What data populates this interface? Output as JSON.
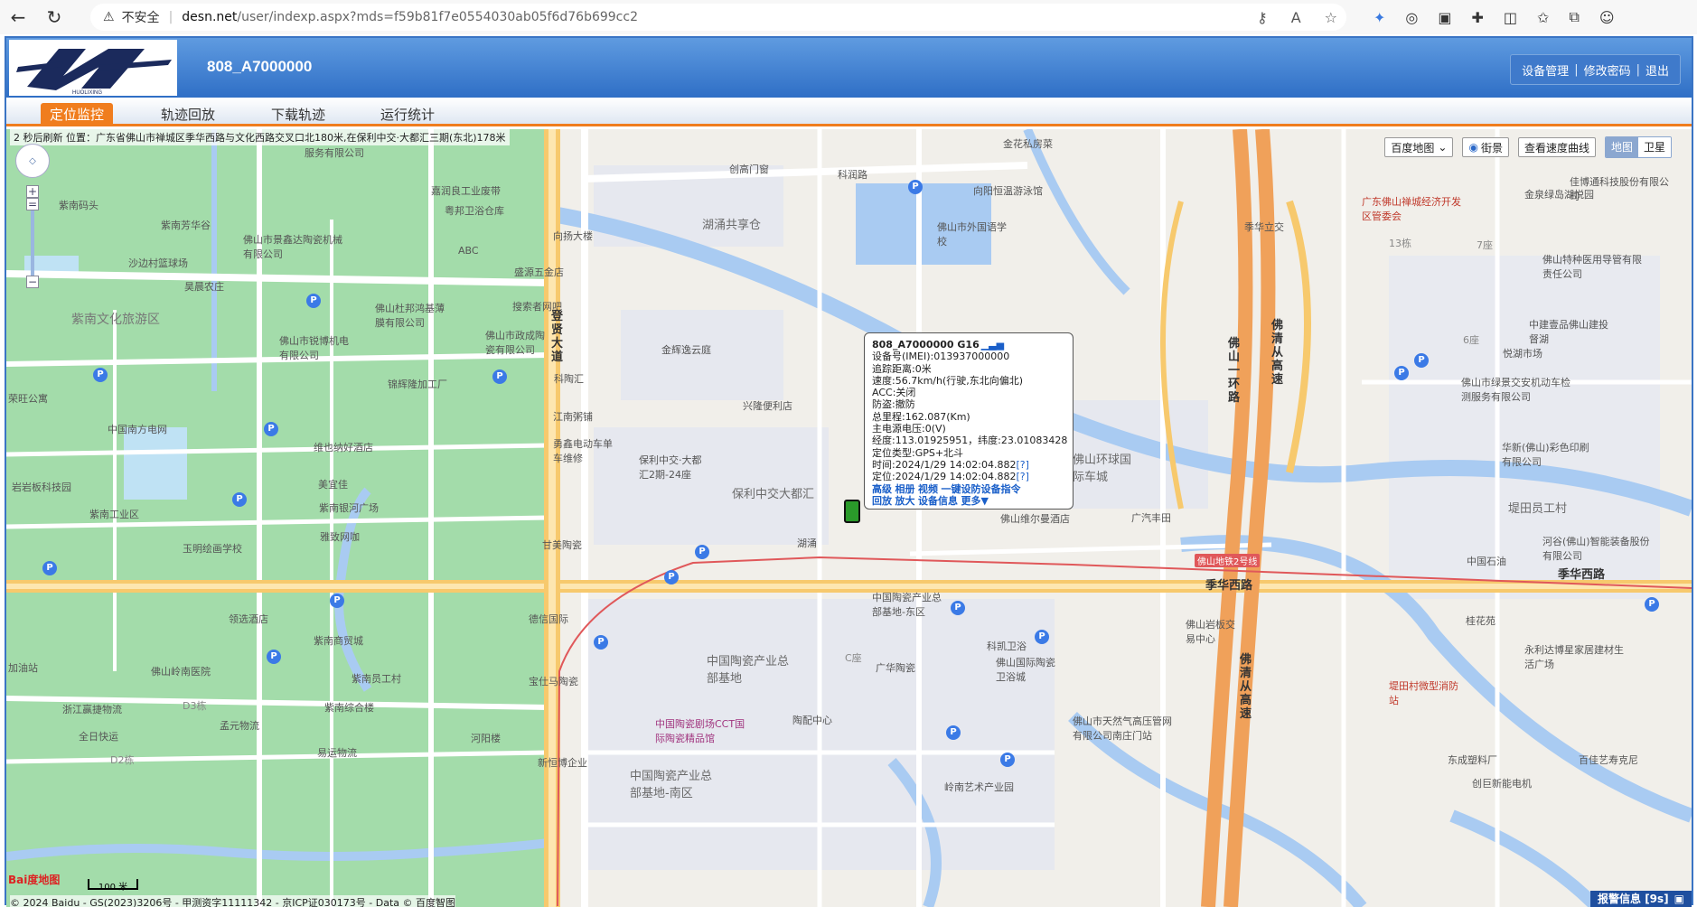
{
  "browser": {
    "insecure_label": "不安全",
    "url_host": "desn.net",
    "url_path": "/user/indexp.aspx?mds=f59b81f7e0554030ab05f6d76b699cc2"
  },
  "header": {
    "logo_text": "HUOLIXING",
    "device_title": "808_A7000000",
    "links": [
      "设备管理",
      "修改密码",
      "退出"
    ]
  },
  "tabs": [
    {
      "label": "定位监控",
      "active": true
    },
    {
      "label": "轨迹回放",
      "active": false
    },
    {
      "label": "下载轨迹",
      "active": false
    },
    {
      "label": "运行统计",
      "active": false
    }
  ],
  "map": {
    "status_line": "2 秒后刷新   位置：广东省佛山市禅城区季华西路与文化西路交叉口北180米,在保利中交·大都汇三期(东北)178米",
    "controls": {
      "map_select": "百度地图",
      "street_view": "街景",
      "speed_curve": "查看速度曲线",
      "type_map": "地图",
      "type_satellite": "卫星"
    },
    "labels": {
      "huyong_gongxiang": "湖涌共享仓",
      "kerun_road": "科润路",
      "chuangmen": "创高门窗",
      "jinfang": "金花私房菜",
      "xiangyang": "向阳恒温游泳馆",
      "foreign_school": "佛山市外国语学校",
      "jiruiliang": "嘉润良工业废带",
      "yuebang": "粤邦卫浴仓库",
      "xiangyang_building": "向扬大楼",
      "abc": "ABC",
      "shengyuan": "盛源五金店",
      "sousuo": "搜索者网吧",
      "jingxin_jinhe": "金辉逸云庭",
      "kefurun": "科陶汇",
      "xinglong": "兴隆便利店",
      "jiangnan": "江南粥铺",
      "yongxin": "勇鑫电动车单车维修",
      "baoli_24": "保利中交·大都汇2期-24座",
      "baoli_dadu": "保利中交大都汇",
      "huyong": "湖涌",
      "dengxian_road": "登贤大道",
      "foshan_ring": "佛山一环路",
      "foqing_highway": "佛清从高速",
      "jihua_west": "季华西路",
      "jihua_li": "季华立交",
      "jihua_west_right": "季华西路",
      "foshan_ring_auto": "佛山环球国际车城",
      "guangqi_fengtian": "广汽丰田",
      "foshan_weierman": "佛山维尔曼酒店",
      "metro_line2": "佛山地铁2号线",
      "ceramics_east": "中国陶瓷产业总部基地-东区",
      "ceramics_hq": "中国陶瓷产业总部基地",
      "ceramics_theatre": "中国陶瓷剧场CCT国际陶瓷精品馆",
      "ceramics_south": "中国陶瓷产业总部基地-南区",
      "taopei": "陶配中心",
      "kekai": "科凯卫浴",
      "foshan_intl_ceramic": "佛山国际陶瓷卫浴城",
      "guanghua": "广华陶瓷",
      "tianran_gas": "佛山市天然气高压管网有限公司南庄门站",
      "lingnan_art": "岭南艺术产业园",
      "xinhengbo": "新恒博企业",
      "baozhi": "宝仕马陶瓷",
      "deli_intl": "德信国际",
      "ganmei": "甘美陶瓷",
      "jingxin_ceramic": "佛山市景鑫达陶瓷机械有限公司",
      "dujuanhong": "佛山杜邦鸿基薄膜有限公司",
      "ruibo": "佛山市锐博机电有限公司",
      "zhengcheng": "佛山市政成陶瓷有限公司",
      "jinpeng": "锦辉隆加工厂",
      "zhongguo_nanfang": "中国南方电网",
      "weiyena": "维也纳好酒店",
      "meiyijia": "美宜佳",
      "ziwu_ruixin": "紫南银河广场",
      "yaxuan_wangka": "雅致网咖",
      "yuming_school": "玉明绘画学校",
      "ziwu_industrial": "紫南工业区",
      "yanyanban": "岩岩板科技园",
      "ziwu_culture": "紫南文化旅游区",
      "shagong_basketball": "沙边村篮球场",
      "ximeizhuang": "昊晨农庄",
      "ziwu_fangyuan": "紫南芳华谷",
      "ziwu_matou": "紫南码头",
      "shabian_park": "荣旺公寓",
      "fuwu_co": "服务有限公司",
      "lingnan_hospital": "佛山岭南医院",
      "zhejiang_logistics": "浙江赢捷物流",
      "quanri_kuaiyun": "全日快运",
      "mengyuan_logistics": "孟元物流",
      "ziwu_zonghe": "紫南综合楼",
      "yida_logistics": "易运物流",
      "hepan_building": "河阳楼",
      "ziwu_yuangong": "紫南员工村",
      "ziwu_shangmao": "紫南商贸城",
      "lingxian_hotel": "领选酒店",
      "jiayou": "加油站",
      "industrial_zone_dev": "广东佛山禅城经济开发区管委会",
      "jinquan_logistics": "金泉绿岛湖悦园",
      "foshan_tejuan": "佛山特种医用导管有限责任公司",
      "zhongjian": "中建壹品佛山建投督湖",
      "yueyang_market": "悦湖市场",
      "lvyou_jiao": "佛山市绿景交安机动车检测服务有限公司",
      "huaxin_color": "华新(佛山)彩色印刷有限公司",
      "dipin_yuangong": "堤田员工村",
      "hegu": "河谷(佛山)智能装备股份有限公司",
      "zhongguo_shiyou": "中国石油",
      "foshan_yanban": "佛山岩板交易中心",
      "guihua_yuan": "桂花苑",
      "yongyuan": "永利达博星家居建材生活广场",
      "dipin_fire": "堤田村微型消防站",
      "dongcheng_plastic": "东成塑料厂",
      "chuangju": "创巨新能电机",
      "baijia": "百佳艺寿克尼",
      "bo_building": "13栋",
      "seven_building": "7座",
      "six_building": "6座",
      "c_building": "C座",
      "d3": "D3栋",
      "d2": "D2栋",
      "qianchao": "佳博通科技股份有限公司"
    },
    "scale_label": "100 米",
    "baidu_logo": "Bai度地图",
    "copyright": "© 2024 Baidu - GS(2023)3206号 - 甲测资字11111342 - 京ICP证030173号 - Data © 百度智图",
    "alert": "报警信息 [9s]"
  },
  "info_window": {
    "title": "808_A7000000 G16",
    "lines": [
      "设备号(IMEI):013937000000",
      "追踪距离:0米",
      "速度:56.7km/h(行驶,东北向偏北)",
      "ACC:关闭",
      "防盗:撤防",
      "总里程:162.087(Km)",
      "主电源电压:0(V)",
      "经度:113.01925951，纬度:23.01083428",
      "定位类型:GPS+北斗",
      "时间:2024/1/29 14:02:04.882",
      "定位:2024/1/29 14:02:04.882"
    ],
    "help_mark": "[?]",
    "actions_row1": [
      "高级",
      "相册",
      "视频",
      "一键设防设备指令"
    ],
    "actions_row2": [
      "回放",
      "放大",
      "设备信息",
      "更多▼"
    ]
  },
  "colors": {
    "header_blue": "#2f6fc6",
    "tab_orange": "#f07d1e",
    "park_green": "#9fd9a5",
    "road_yellow": "#f7c96d",
    "water_blue": "#a9cbf2"
  }
}
